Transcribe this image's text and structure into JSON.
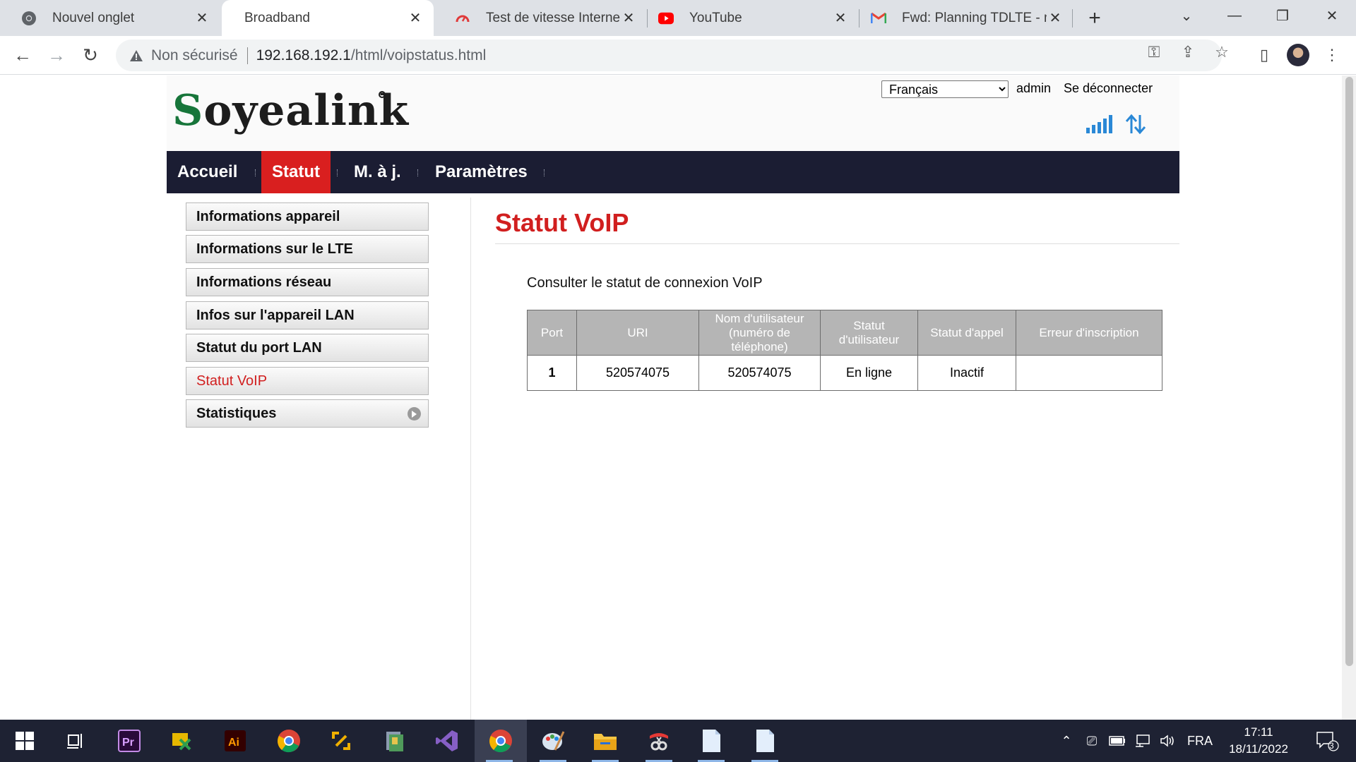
{
  "browser": {
    "tabs": [
      {
        "title": "Nouvel onglet",
        "icon": "chrome-icon"
      },
      {
        "title": "Broadband",
        "icon": "none",
        "active": true
      },
      {
        "title": "Test de vitesse Internet | F",
        "icon": "speedtest-icon"
      },
      {
        "title": "YouTube",
        "icon": "youtube-icon"
      },
      {
        "title": "Fwd: Planning TDLTE - mc",
        "icon": "gmail-icon"
      }
    ],
    "security_label": "Non sécurisé",
    "url_host": "192.168.192.1",
    "url_path": "/html/voipstatus.html"
  },
  "header": {
    "logo_text": "Soyealink",
    "language_options": [
      "Français"
    ],
    "language_selected": "Français",
    "user": "admin",
    "logout": "Se déconnecter"
  },
  "nav": {
    "items": [
      {
        "label": "Accueil"
      },
      {
        "label": "Statut",
        "active": true
      },
      {
        "label": "M. à j."
      },
      {
        "label": "Paramètres"
      }
    ]
  },
  "sidebar": {
    "items": [
      {
        "label": "Informations appareil"
      },
      {
        "label": "Informations sur le LTE"
      },
      {
        "label": "Informations réseau"
      },
      {
        "label": "Infos sur l'appareil LAN"
      },
      {
        "label": "Statut du port LAN"
      },
      {
        "label": "Statut VoIP",
        "active": true
      },
      {
        "label": "Statistiques",
        "has_submenu": true
      }
    ]
  },
  "content": {
    "title": "Statut VoIP",
    "description": "Consulter le statut de connexion VoIP",
    "table": {
      "headers": [
        "Port",
        "URI",
        "Nom d'utilisateur (numéro de téléphone)",
        "Statut d'utilisateur",
        "Statut d'appel",
        "Erreur d'inscription"
      ],
      "rows": [
        [
          "1",
          "520574075",
          "520574075",
          "En ligne",
          "Inactif",
          ""
        ]
      ]
    }
  },
  "taskbar": {
    "language": "FRA",
    "time": "17:11",
    "date": "18/11/2022",
    "notification_count": "3"
  },
  "colors": {
    "brand_red": "#d11f1f",
    "nav_bg": "#1b1d33",
    "logo_green": "#17753a",
    "signal_blue": "#2a88d6"
  }
}
